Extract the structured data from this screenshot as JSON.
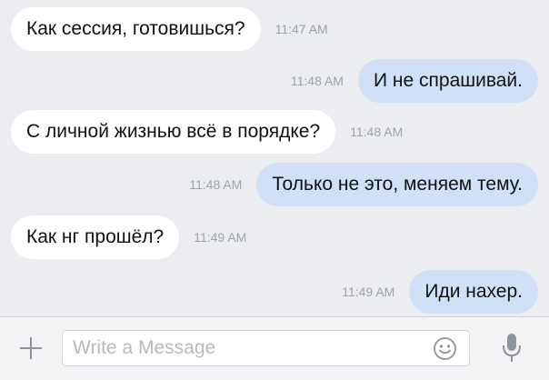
{
  "conversation": {
    "messages": [
      {
        "direction": "incoming",
        "text": "Как сессия, готовишься?",
        "time": "11:47 AM"
      },
      {
        "direction": "outgoing",
        "text": "И не спрашивай.",
        "time": "11:48 AM"
      },
      {
        "direction": "incoming",
        "text": "С личной жизнью всё в порядке?",
        "time": "11:48 AM"
      },
      {
        "direction": "outgoing",
        "text": "Только не это, меняем тему.",
        "time": "11:48 AM"
      },
      {
        "direction": "incoming",
        "text": "Как нг прошёл?",
        "time": "11:49 AM"
      },
      {
        "direction": "outgoing",
        "text": "Иди нахер.",
        "time": "11:49 AM"
      }
    ]
  },
  "composer": {
    "placeholder": "Write a Message",
    "value": "",
    "attach_icon": "plus-icon",
    "emoji_icon": "smiley-icon",
    "voice_icon": "microphone-icon"
  },
  "colors": {
    "background": "#ebedf1",
    "incoming_bubble": "#ffffff",
    "outgoing_bubble": "#cfe0f7",
    "timestamp": "#9fa4ab",
    "icon": "#8e949b"
  }
}
